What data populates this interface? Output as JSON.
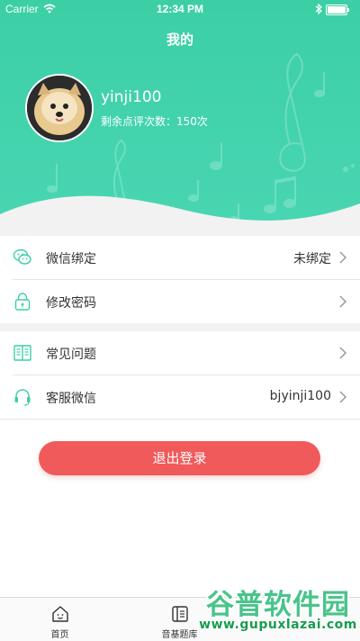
{
  "status_bar": {
    "carrier": "Carrier",
    "time": "12:34 PM"
  },
  "header": {
    "title": "我的"
  },
  "profile": {
    "username": "yinji100",
    "remaining_label": "剩余点评次数：150次"
  },
  "menu_group_1": [
    {
      "label": "微信绑定",
      "value": "未绑定",
      "icon": "wechat-icon"
    },
    {
      "label": "修改密码",
      "value": "",
      "icon": "lock-icon"
    }
  ],
  "menu_group_2": [
    {
      "label": "常见问题",
      "value": "",
      "icon": "book-icon"
    },
    {
      "label": "客服微信",
      "value": "bjyinji100",
      "icon": "headset-icon"
    }
  ],
  "logout_label": "退出登录",
  "tabbar": [
    {
      "label": "首页",
      "icon": "home-icon"
    },
    {
      "label": "音基题库",
      "icon": "question-bank-icon"
    }
  ],
  "watermark": {
    "text": "谷普软件园",
    "url": "www.gupuxlazai.com"
  },
  "colors": {
    "accent": "#3ccfa6",
    "logout": "#f05a5b",
    "icon": "#3ccfa6"
  }
}
